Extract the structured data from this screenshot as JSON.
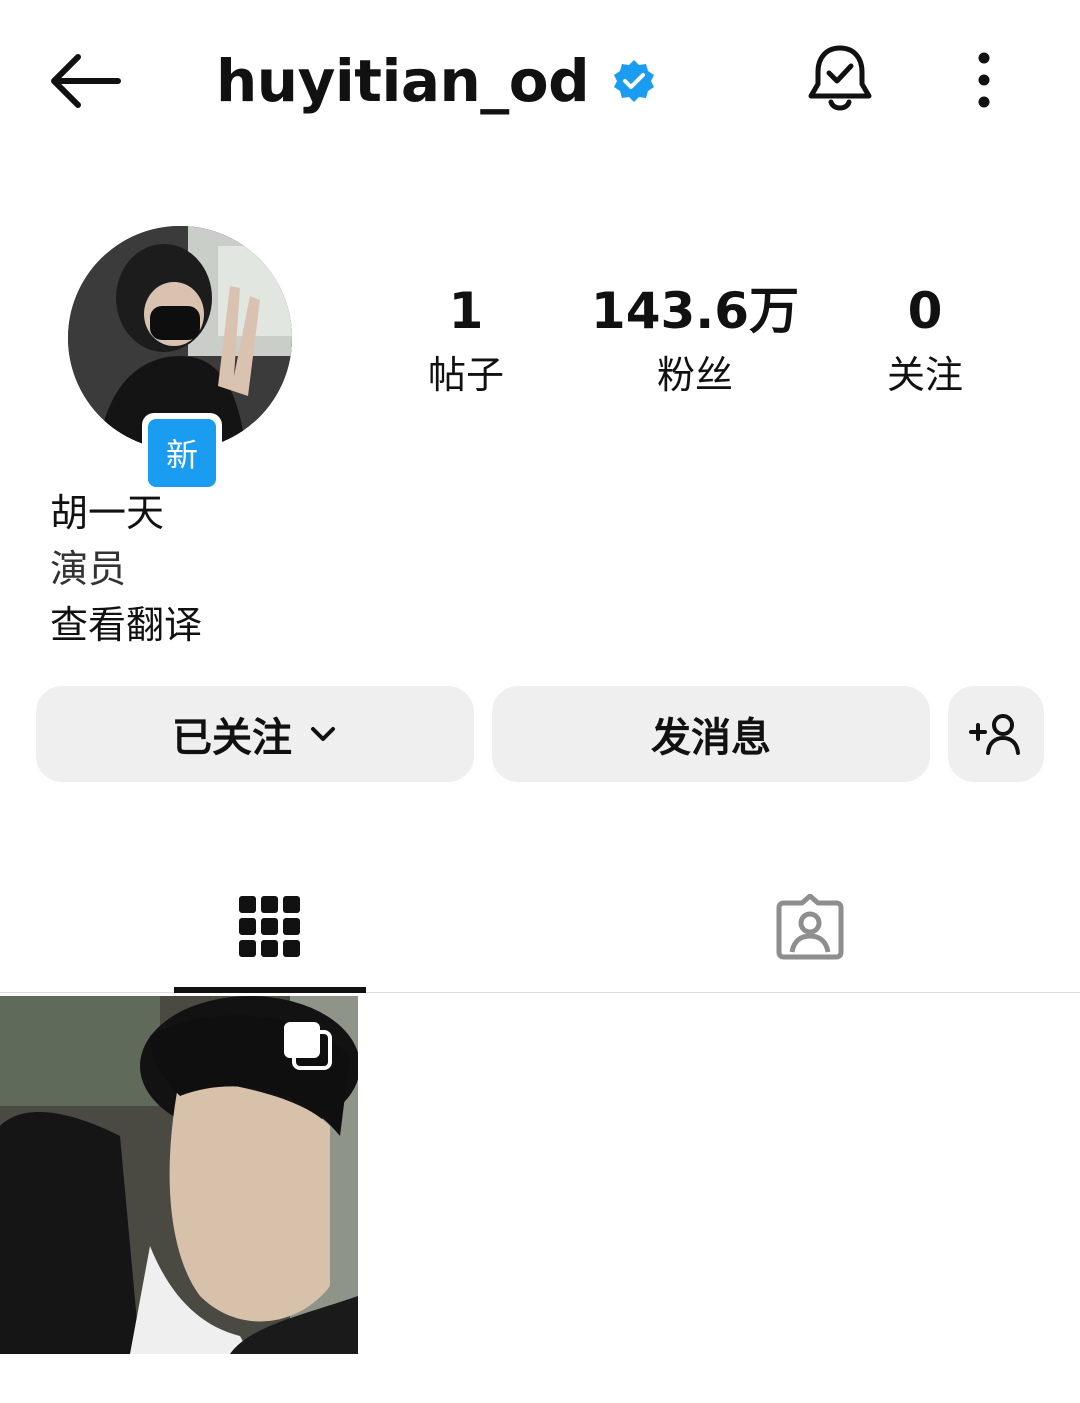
{
  "header": {
    "username": "huyitian_od",
    "verified": true
  },
  "profile": {
    "new_badge": "新",
    "display_name": "胡一天",
    "category": "演员",
    "translate_link": "查看翻译"
  },
  "stats": [
    {
      "value": "1",
      "label": "帖子"
    },
    {
      "value": "143.6万",
      "label": "粉丝"
    },
    {
      "value": "0",
      "label": "关注"
    }
  ],
  "actions": {
    "following_label": "已关注",
    "message_label": "发消息"
  },
  "colors": {
    "verified_blue": "#1a9cf0",
    "button_bg": "#efefef",
    "tab_active": "#111111",
    "tab_inactive": "#8e8e8e"
  },
  "icons": {
    "back": "arrow-left",
    "notifications": "bell-check",
    "more": "vertical-ellipsis",
    "add_user": "person-plus",
    "grid_tab": "grid",
    "tagged_tab": "person-frame",
    "carousel": "stacked-squares"
  }
}
